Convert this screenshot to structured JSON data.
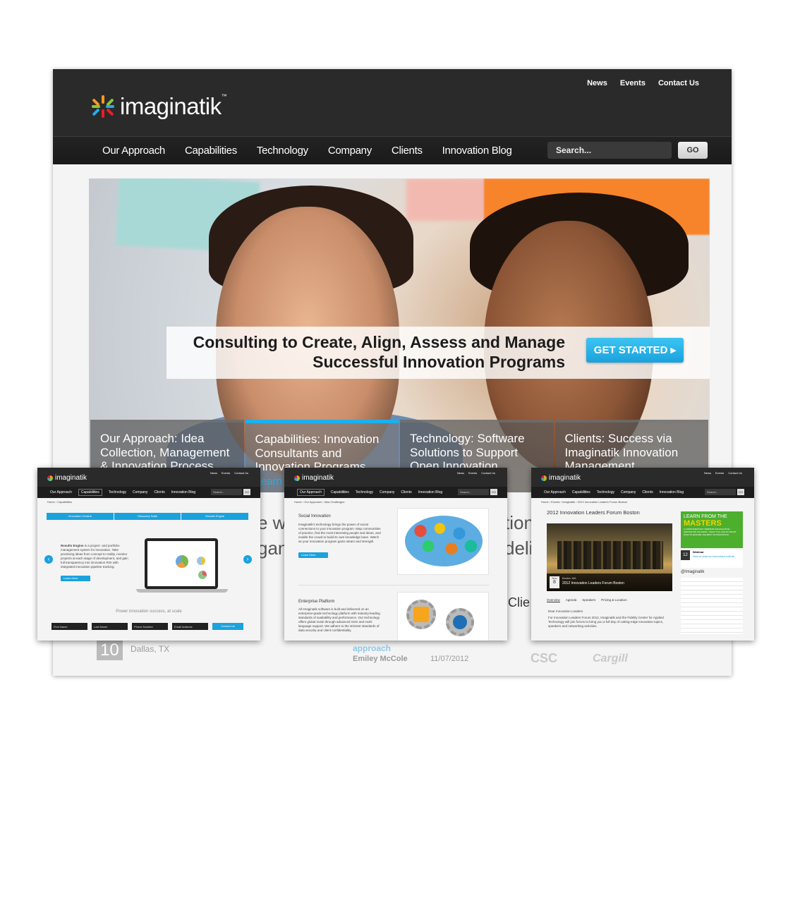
{
  "main": {
    "brand": "imaginatik",
    "brand_tm": "™",
    "utility_nav": [
      "News",
      "Events",
      "Contact Us"
    ],
    "nav": [
      "Our Approach",
      "Capabilities",
      "Technology",
      "Company",
      "Clients",
      "Innovation Blog"
    ],
    "search_placeholder": "Search...",
    "go_label": "GO",
    "hero": {
      "headline_line1": "Consulting to Create, Align, Assess and Manage",
      "headline_line2": "Successful Innovation Programs",
      "cta": "GET STARTED ▸"
    },
    "panels": [
      {
        "text": "Our Approach: Idea Collection, Management & Innovation Process"
      },
      {
        "text": "Capabilities: Innovation Consultants and Innovation Programs",
        "more": "Learn"
      },
      {
        "text": "Technology: Software Solutions to Support Open Innovation"
      },
      {
        "text": "Clients: Success via Imaginatik Innovation Management"
      }
    ],
    "below": {
      "frag1": "e w",
      "frag2": "gani",
      "frag3": "tion",
      "frag4": "deli",
      "frag5": "Clie",
      "event_day": "10",
      "event_city": "Dallas, TX",
      "blog_title": "approach",
      "blog_author": "Emiley McCole",
      "blog_date": "11/07/2012",
      "logo1": "CSC",
      "logo2": "Cargill"
    }
  },
  "mini1": {
    "brand": "imaginatik",
    "util": [
      "News",
      "Events",
      "Contact Us"
    ],
    "nav": [
      "Our Approach",
      "Capabilities",
      "Technology",
      "Company",
      "Clients",
      "Innovation Blog"
    ],
    "search": "Search...",
    "go": "GO",
    "crumb": "Home › Capabilities",
    "tabs": [
      "Innovation Central",
      "Discovery Suite",
      "Results Engine"
    ],
    "body_bold": "Results Engine",
    "body": " is a project- and portfolio-management system for innovation. Take promising ideas from concept to reality, monitor projects at each stage of development, and gain full transparency into innovation ROI with integrated innovation pipeline tracking.",
    "learn_more": "Learn More",
    "tagline": "Power innovation success, at scale",
    "fields": [
      "First Name",
      "Last Name",
      "Phone Number",
      "Email Address"
    ],
    "contact_btn": "Contact Us"
  },
  "mini2": {
    "brand": "imaginatik",
    "util": [
      "News",
      "Events",
      "Contact Us"
    ],
    "nav": [
      "Our Approach",
      "Capabilities",
      "Technology",
      "Company",
      "Clients",
      "Innovation Blog"
    ],
    "search": "Search...",
    "go": "GO",
    "crumb": "Home › Our Approach › Idea Challenges",
    "s1_title": "Social Innovation",
    "s1_body": "Imaginatik's technology brings the power of social connections to your innovation program. Map communities of practice, find the most interesting people and ideas, and enable the crowd to build its own knowledge base. Watch as your innovation program gains steam and strength.",
    "learn_more": "Learn More",
    "s2_title": "Enterprise Platform",
    "s2_body": "All Imaginatik software is built and delivered on an enterprise-grade technology platform with industry-leading standards of availability and performance. Our technology offers global scale through advanced SSO and multi-language support. We adhere to the strictest standards of data security and client confidentiality."
  },
  "mini3": {
    "brand": "imaginatik",
    "util": [
      "News",
      "Events",
      "Contact Us"
    ],
    "nav": [
      "Our Approach",
      "Capabilities",
      "Technology",
      "Company",
      "Clients",
      "Innovation Blog"
    ],
    "search": "Search...",
    "go": "GO",
    "crumb": "Home › Events › Imaginatik › 2012 Innovation Leaders Forum Boston",
    "title": "2012 Innovation Leaders Forum Boston",
    "date_month": "Nov",
    "date_day": "8",
    "event_loc": "Boston MA",
    "event_name": "2012 Innovation Leaders Forum Boston",
    "tabs": [
      "Overview",
      "Agenda",
      "Speakers",
      "Pricing & Location"
    ],
    "body_head": "Dear Innovation Leaders",
    "body": "For Innovation Leaders Forum 2012, Imaginatik and the Fidelity Center for Applied Technology will join forces to bring you a full day of cutting-edge innovation topics, speakers and networking activities.",
    "ad_line1": "LEARN FROM THE",
    "ad_line2": "MASTERS",
    "ad_sub": "A COMPLIMENTARY WEBINAR HIGHLIGHTING INNOVATION SUCCESS - WHAT YOU CAN DO RIGHT NOW TO ENSURE THE BEST IN INNOVATION",
    "webinar_day": "12",
    "webinar_label": "Webinar",
    "webinar_title": "How to lead an innovation culture",
    "twitter": "@Imaginatik"
  },
  "colors": {
    "accent": "#1cb0ee",
    "dark": "#2a2a2a",
    "ad_green": "#4caf2e"
  }
}
